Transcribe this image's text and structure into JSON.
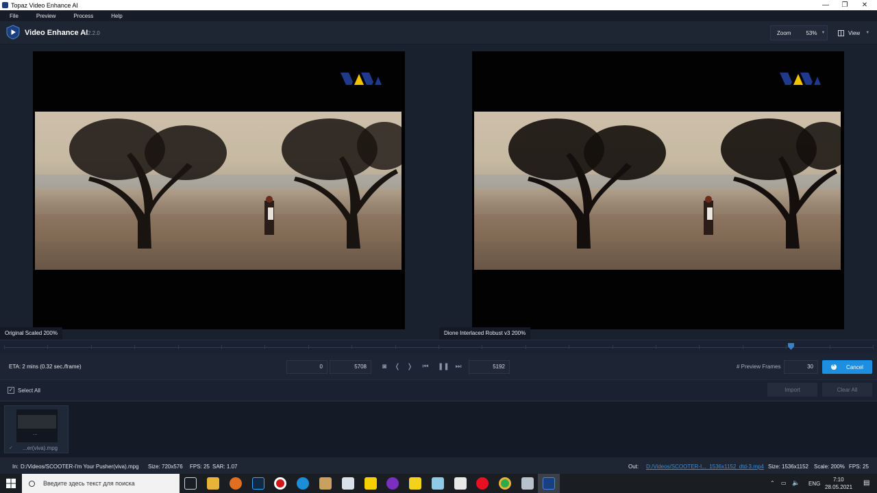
{
  "window": {
    "title": "Topaz Video Enhance AI",
    "minimize_glyph": "—",
    "restore_glyph": "❐",
    "close_glyph": "✕"
  },
  "menu": {
    "items": [
      "File",
      "Preview",
      "Process",
      "Help"
    ]
  },
  "header": {
    "app_name": "Video Enhance AI",
    "version": "v2.2.0",
    "zoom_label": "Zoom",
    "zoom_value": "53%",
    "view_label": "View"
  },
  "preview": {
    "left_label": "Original Scaled 200%",
    "right_label": "Dione Interlaced Robust v3 200%"
  },
  "timeline": {
    "playhead_position": 0.906
  },
  "controls": {
    "eta": "ETA:  2 mins  (0.32 sec./frame)",
    "start_frame": "0",
    "end_frame": "5708",
    "current_frame": "5192",
    "preview_frames_label": "# Preview Frames",
    "preview_frames_value": "30",
    "cancel_label": "Cancel"
  },
  "selection": {
    "select_all_label": "Select All",
    "import_label": "Import",
    "clear_all_label": "Clear All"
  },
  "file_list": [
    {
      "name": "...er(viva).mpg",
      "thumb_text": "..."
    }
  ],
  "status": {
    "in_label": "In:",
    "in_path": "D:/Videos/SCOOTER-I'm Your Pusher(viva).mpg",
    "in_size": "Size: 720x576",
    "in_fps": "FPS: 25",
    "in_sar": "SAR: 1.07",
    "out_label": "Out:",
    "out_path": "D:/Videos/SCOOTER-I..._1536x1152_dtd-3.mp4",
    "out_size": "Size: 1536x1152",
    "out_scale": "Scale: 200%",
    "out_fps": "FPS: 25"
  },
  "taskbar": {
    "search_placeholder": "Введите здесь текст для поиска",
    "language": "ENG",
    "time": "7:10",
    "date": "28.05.2021"
  },
  "colors": {
    "accent": "#1e8fe0",
    "background": "#1b2230",
    "link": "#3f8ed6"
  }
}
